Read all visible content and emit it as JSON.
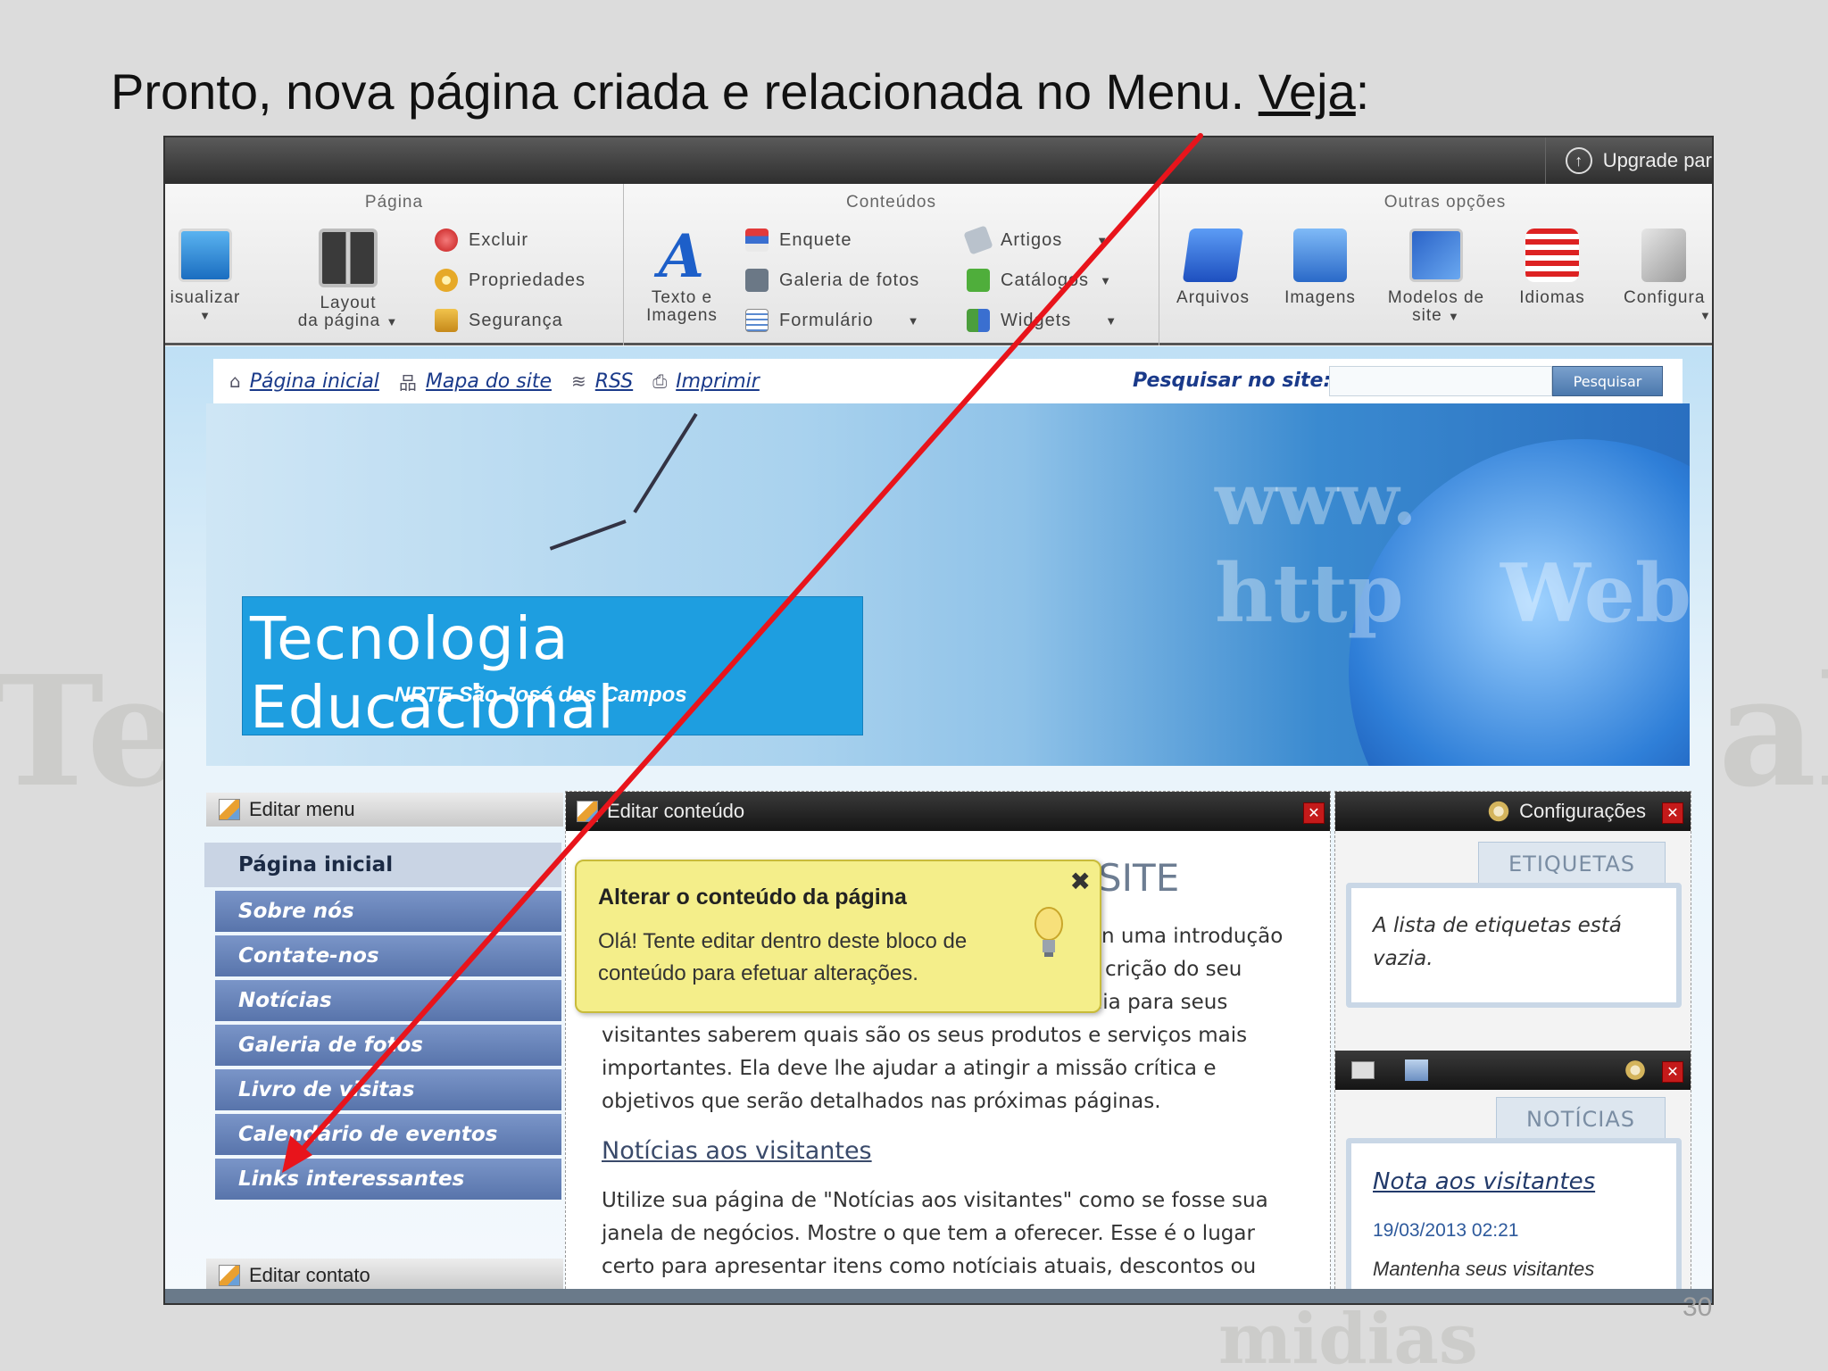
{
  "slide": {
    "title_prefix": "Pronto, nova página criada e relacionada no Menu. ",
    "title_link": "Veja",
    "title_suffix": ":",
    "page_number": "30",
    "background_words": [
      "Te",
      "al",
      "midias"
    ]
  },
  "cms": {
    "upgrade_label": "Upgrade par",
    "ribbon": {
      "groups": [
        {
          "title": "Página"
        },
        {
          "title": "Conteúdos"
        },
        {
          "title": "Outras opções"
        }
      ],
      "visualizar": "isualizar",
      "layout_line1": "Layout",
      "layout_line2": "da página",
      "excluir": "Excluir",
      "propriedades": "Propriedades",
      "seguranca": "Segurança",
      "texto_line1": "Texto e",
      "texto_line2": "Imagens",
      "enquete": "Enquete",
      "galeria_fotos": "Galeria de fotos",
      "formulario": "Formulário",
      "artigos": "Artigos",
      "catalogos": "Catálogos",
      "widgets": "Widgets",
      "arquivos": "Arquivos",
      "imagens": "Imagens",
      "modelos_line1": "Modelos de",
      "modelos_line2": "site",
      "idiomas": "Idiomas",
      "configuracoes": "Configura"
    }
  },
  "site": {
    "nav": {
      "home": "Página inicial",
      "sitemap": "Mapa do site",
      "rss": "RSS",
      "print": "Imprimir",
      "search_label": "Pesquisar no site:",
      "search_value": "",
      "search_button": "Pesquisar"
    },
    "banner": {
      "title": "Tecnologia Educacional",
      "subtitle": "NRTE São José dos Campos",
      "watermark1": "www.",
      "watermark2": "http",
      "watermark3": "Web"
    },
    "edit_menu_label": "Editar menu",
    "edit_contact_label": "Editar contato",
    "menu_items": [
      "Página inicial",
      "Sobre nós",
      "Contate-nos",
      "Notícias",
      "Galeria de fotos",
      "Livro de visitas",
      "Calendário de eventos",
      "Links interessantes"
    ],
    "content": {
      "edit_label": "Editar conteúdo",
      "heading_fragment": "SITE",
      "partial_line1": "n uma introdução",
      "partial_line2": "crição do seu",
      "partial_line3": "projeto, objetivos e metas. Ela deverá ser um guia para seus",
      "para_lines": [
        "visitantes saberem quais são os seus produtos e serviços mais",
        "importantes. Ela deve lhe ajudar a atingir a missão crítica e",
        "objetivos que serão detalhados nas próximas páginas."
      ],
      "news_heading": "Notícias aos visitantes",
      "news_lines": [
        "Utilize sua página de \"Notícias aos visitantes\" como se fosse sua",
        "janela de negócios. Mostre o que tem a oferecer. Esse é o lugar",
        "certo para apresentar itens como notíciais atuais, descontos ou"
      ]
    },
    "tooltip": {
      "title": "Alterar o conteúdo da página",
      "body": "Olá! Tente editar dentro deste bloco de conteúdo para efetuar alterações.",
      "close": "✖"
    },
    "sidebar": {
      "config_label": "Configurações",
      "tags_title": "ETIQUETAS",
      "tags_empty": "A lista de etiquetas está vazia.",
      "news_title": "NOTÍCIAS",
      "news_item_title": "Nota aos visitantes",
      "news_item_date": "19/03/2013 02:21",
      "news_item_excerpt": "Mantenha seus visitantes"
    }
  },
  "colors": {
    "annotation_arrow": "#e8141b",
    "menu_item": "#5f7bb1",
    "tooltip_bg": "#f4ee8a",
    "banner_title_bg": "#1e9ee0"
  }
}
